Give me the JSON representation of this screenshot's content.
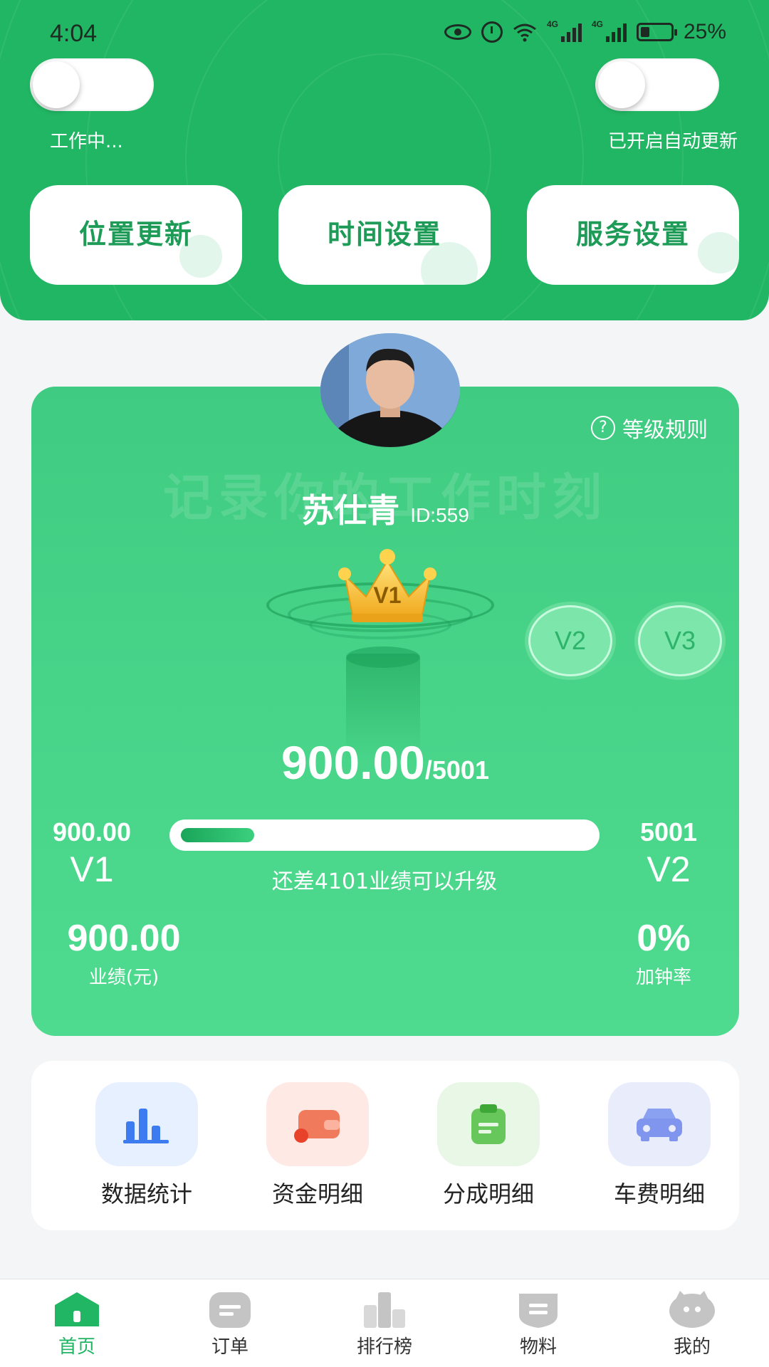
{
  "status_bar": {
    "time": "4:04",
    "battery": "25%",
    "icons": [
      "eye-icon",
      "alarm-icon",
      "wifi-icon",
      "signal-4g-icon",
      "signal-4g-icon",
      "battery-icon"
    ]
  },
  "header": {
    "work_toggle": {
      "label": "工作中...",
      "on": false
    },
    "auto_update_toggle": {
      "label": "已开启自动更新",
      "on": false
    },
    "buttons": [
      {
        "label": "位置更新",
        "icon": "location-icon"
      },
      {
        "label": "时间设置",
        "icon": "clock-icon"
      },
      {
        "label": "服务设置",
        "icon": "heart-icon"
      }
    ]
  },
  "level_card": {
    "watermark": "记录你的工作时刻",
    "rules_label": "等级规则",
    "user_name": "苏仕青",
    "user_id": "ID:559",
    "current_level": "V1",
    "next_badges": [
      "V2",
      "V3"
    ],
    "score": "900.00",
    "score_target": "/5001",
    "left_value": "900.00",
    "left_level": "V1",
    "right_value": "5001",
    "right_level": "V2",
    "progress_fraction": 0.18,
    "progress_hint": "还差4101业绩可以升级",
    "performance_value": "900.00",
    "performance_label": "业绩(元)",
    "overtime_value": "0%",
    "overtime_label": "加钟率"
  },
  "quick_menu": [
    {
      "label": "数据统计",
      "icon": "bar-chart-icon",
      "bg": "#e6f0ff",
      "color": "#3d7cf0"
    },
    {
      "label": "资金明细",
      "icon": "wallet-icon",
      "bg": "#ffe9e4",
      "color": "#f06a4a"
    },
    {
      "label": "分成明细",
      "icon": "clipboard-icon",
      "bg": "#e8f7e6",
      "color": "#58bf4a"
    },
    {
      "label": "车费明细",
      "icon": "car-icon",
      "bg": "#e9ecfb",
      "color": "#7f95ee"
    }
  ],
  "tabbar": [
    {
      "label": "首页",
      "icon": "home-icon",
      "active": true
    },
    {
      "label": "订单",
      "icon": "order-icon",
      "active": false
    },
    {
      "label": "排行榜",
      "icon": "ranking-icon",
      "active": false
    },
    {
      "label": "物料",
      "icon": "material-icon",
      "active": false
    },
    {
      "label": "我的",
      "icon": "profile-icon",
      "active": false
    }
  ],
  "colors": {
    "brand_green": "#21b664",
    "card_green": "#47d388",
    "button_text": "#1e9c57"
  }
}
